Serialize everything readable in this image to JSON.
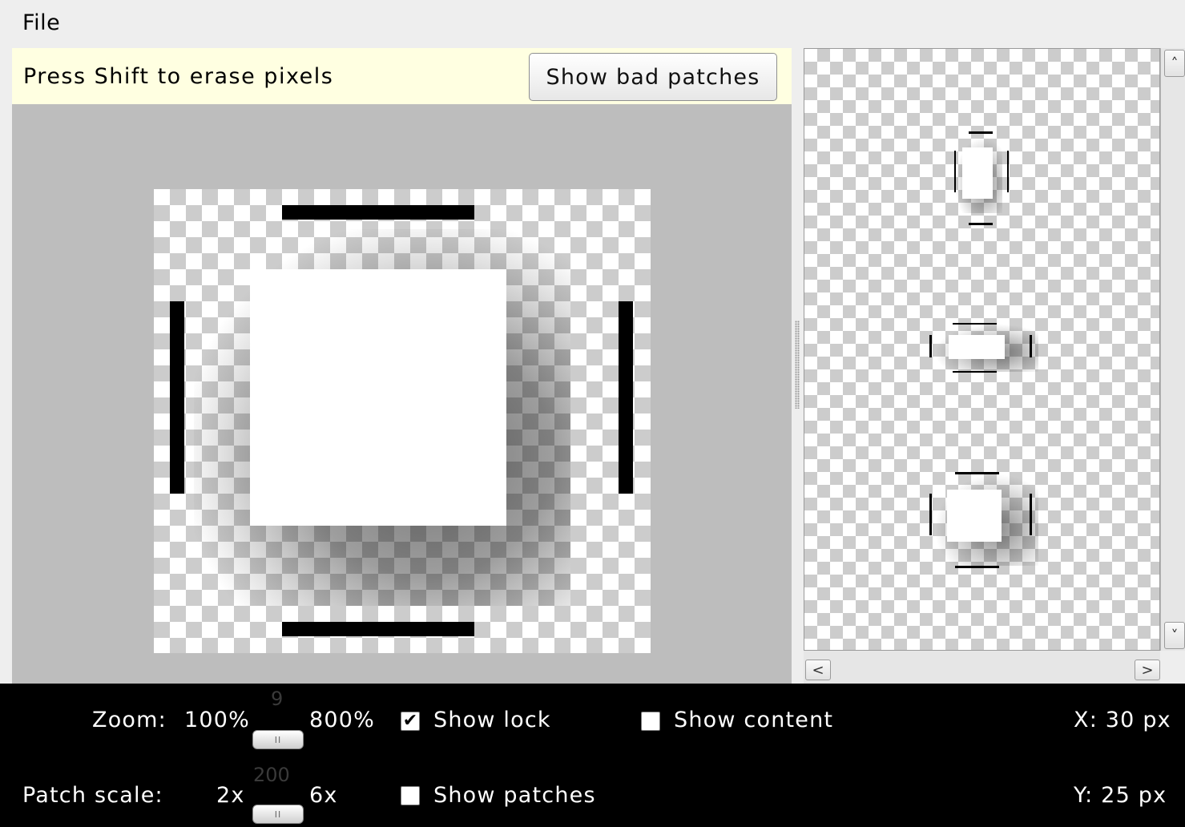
{
  "menu": {
    "file": "File"
  },
  "editor": {
    "hint": "Press Shift to erase pixels",
    "show_bad_patches_label": "Show bad patches"
  },
  "scrollbars": {
    "up_arrow": "˄",
    "down_arrow": "˅",
    "left_arrow": "<",
    "right_arrow": ">"
  },
  "status": {
    "zoom_label": "Zoom:",
    "zoom_min": "100%",
    "zoom_value": "9",
    "zoom_max": "800%",
    "patch_scale_label": "Patch scale:",
    "patch_min": "2x",
    "patch_value": "200",
    "patch_max": "6x",
    "show_lock_label": "Show lock",
    "show_lock_checked": true,
    "show_content_label": "Show content",
    "show_content_checked": false,
    "show_patches_label": "Show patches",
    "show_patches_checked": false,
    "x_readout": "X: 30 px",
    "y_readout": "Y: 25 px",
    "slider_grip": "II"
  },
  "colors": {
    "hint_background": "#ffffe1",
    "editor_background": "#bdbdbd",
    "status_background": "#000000",
    "checker_dark": "#cccccc"
  }
}
